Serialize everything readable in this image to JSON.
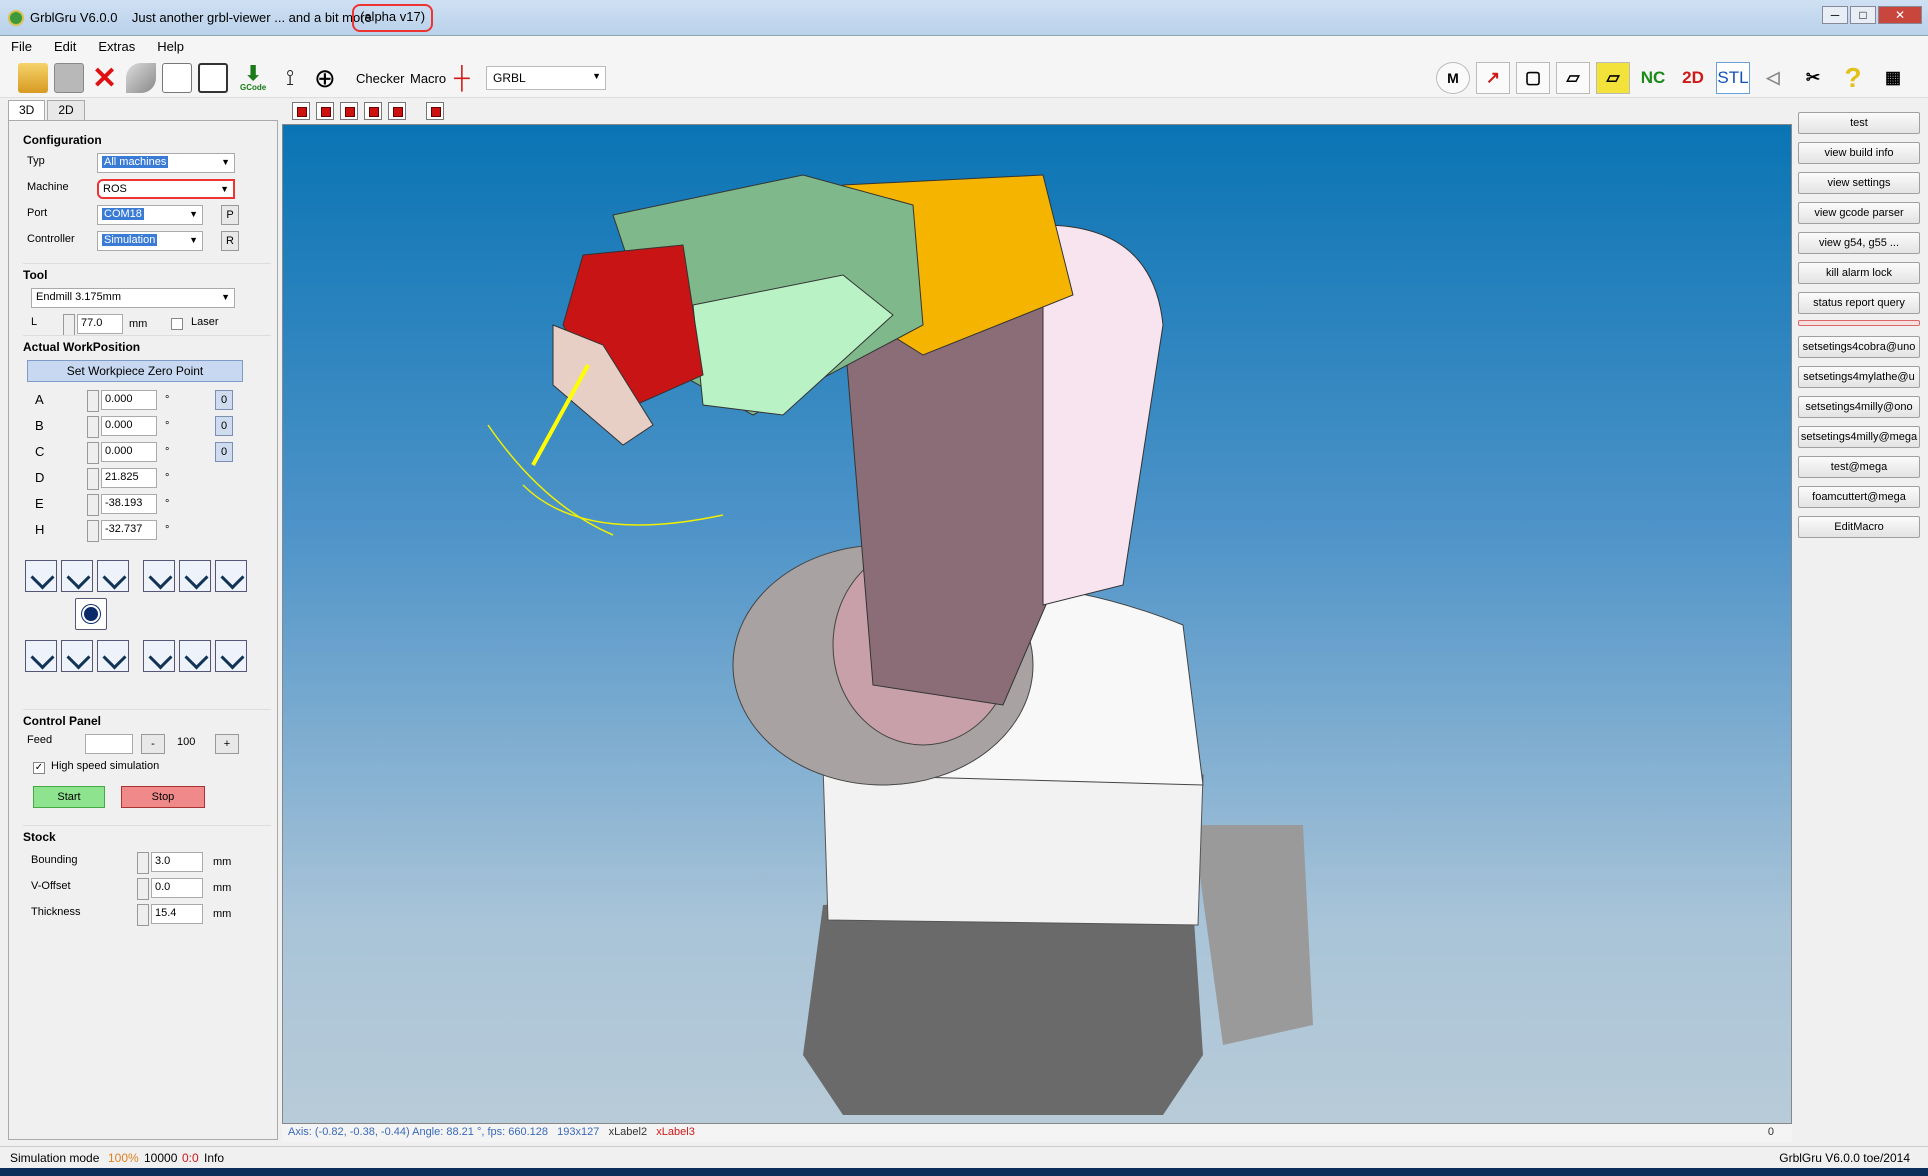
{
  "window": {
    "title": "GrblGru V6.0.0",
    "subtitle": "Just another grbl-viewer ... and a bit more",
    "version_badge": "(alpha v17)",
    "buttons": {
      "minimize": "─",
      "maximize": "□",
      "close": "✕"
    }
  },
  "menu": [
    "File",
    "Edit",
    "Extras",
    "Help"
  ],
  "toolbar": {
    "gcode_label": "GCode",
    "checker": "Checker",
    "macro": "Macro",
    "controller_select": "GRBL",
    "right_labels": {
      "nc": "NC",
      "twod": "2D",
      "stl": "STL"
    },
    "colors": {
      "nc": "#1a8a1a",
      "twod": "#d01818",
      "stl": "#1050b8"
    }
  },
  "left": {
    "tabs": [
      "3D",
      "2D"
    ],
    "configuration": {
      "title": "Configuration",
      "typ_label": "Typ",
      "typ_value": "All machines",
      "machine_label": "Machine",
      "machine_value": "ROS",
      "port_label": "Port",
      "port_value": "COM18",
      "port_btn": "P",
      "controller_label": "Controller",
      "controller_value": "Simulation",
      "controller_btn": "R"
    },
    "tool": {
      "title": "Tool",
      "tool_value": "Endmill 3.175mm",
      "l_label": "L",
      "l_value": "77.0",
      "l_unit": "mm",
      "laser_label": "Laser"
    },
    "workposition": {
      "title": "Actual WorkPosition",
      "set_zero": "Set Workpiece Zero Point",
      "axes": [
        {
          "name": "A",
          "value": "0.000",
          "unit": "°",
          "zero": "0"
        },
        {
          "name": "B",
          "value": "0.000",
          "unit": "°",
          "zero": "0"
        },
        {
          "name": "C",
          "value": "0.000",
          "unit": "°",
          "zero": "0"
        },
        {
          "name": "D",
          "value": "21.825",
          "unit": "°"
        },
        {
          "name": "E",
          "value": "-38.193",
          "unit": "°"
        },
        {
          "name": "H",
          "value": "-32.737",
          "unit": "°"
        }
      ]
    },
    "control_panel": {
      "title": "Control Panel",
      "feed_label": "Feed",
      "feed_value": "",
      "minus": "-",
      "feed_pct": "100",
      "plus": "+",
      "high_speed": "High speed simulation",
      "start": "Start",
      "stop": "Stop"
    },
    "stock": {
      "title": "Stock",
      "bounding_label": "Bounding",
      "bounding_value": "3.0",
      "voffset_label": "V-Offset",
      "voffset_value": "0.0",
      "thickness_label": "Thickness",
      "thickness_value": "15.4",
      "unit": "mm"
    }
  },
  "viewport": {
    "status_axis": "Axis: (-0.82, -0.38, -0.44) Angle: 88.21 °, fps: 660.128",
    "status_size": "193x127",
    "xlabel2": "xLabel2",
    "xlabel3": "xLabel3",
    "right_value": "0"
  },
  "right_buttons": [
    "test",
    "view build info",
    "view settings",
    "view gcode parser",
    "view g54, g55 ...",
    "kill alarm lock",
    "status report query",
    "",
    "setsetings4cobra@uno",
    "setsetings4mylathe@u",
    "setsetings4milly@ono",
    "setsetings4milly@mega",
    "test@mega",
    "foamcuttert@mega",
    "EditMacro"
  ],
  "bottom": {
    "mode": "Simulation mode",
    "pct": "100%",
    "count": "10000",
    "zero": "0:0",
    "info": "Info",
    "version": "GrblGru V6.0.0 toe/2014"
  }
}
